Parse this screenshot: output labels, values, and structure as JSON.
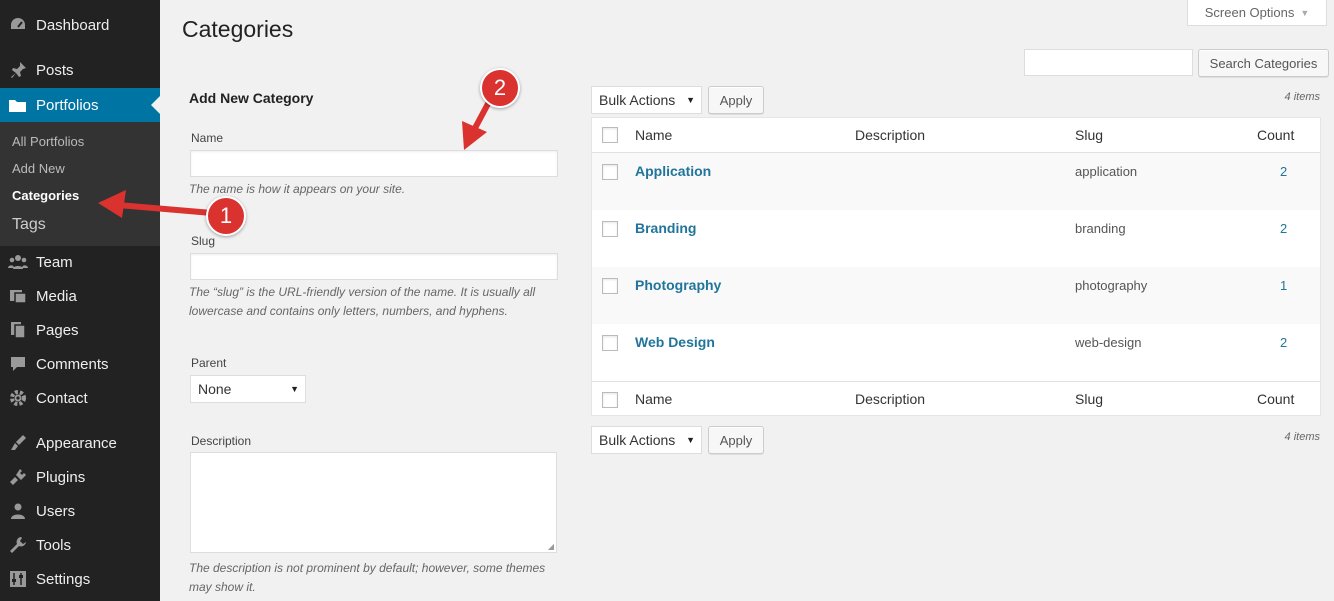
{
  "sidebar": {
    "menu": [
      {
        "label": "Dashboard",
        "icon": "dashboard-icon"
      },
      {
        "label": "Posts",
        "icon": "pin-icon"
      },
      {
        "label": "Portfolios",
        "icon": "folder-icon"
      },
      {
        "label": "Team",
        "icon": "group-icon"
      },
      {
        "label": "Media",
        "icon": "media-icon"
      },
      {
        "label": "Pages",
        "icon": "pages-icon"
      },
      {
        "label": "Comments",
        "icon": "comment-icon"
      },
      {
        "label": "Contact",
        "icon": "gear-icon"
      },
      {
        "label": "Appearance",
        "icon": "brush-icon"
      },
      {
        "label": "Plugins",
        "icon": "plug-icon"
      },
      {
        "label": "Users",
        "icon": "user-icon"
      },
      {
        "label": "Tools",
        "icon": "wrench-icon"
      },
      {
        "label": "Settings",
        "icon": "sliders-icon"
      }
    ],
    "submenu": [
      "All Portfolios",
      "Add New",
      "Categories",
      "Tags"
    ]
  },
  "header": {
    "title": "Categories",
    "screen_options": "Screen Options",
    "search_button": "Search Categories",
    "search_value": ""
  },
  "form": {
    "heading": "Add New Category",
    "name_label": "Name",
    "name_help": "The name is how it appears on your site.",
    "slug_label": "Slug",
    "slug_help_1": "The “slug” is the URL-friendly version of the name. It is usually all",
    "slug_help_2": "lowercase and contains only letters, numbers, and hyphens.",
    "parent_label": "Parent",
    "parent_value": "None",
    "description_label": "Description",
    "description_help_1": "The description is not prominent by default; however, some themes",
    "description_help_2": "may show it."
  },
  "table": {
    "bulk_actions": "Bulk Actions",
    "apply": "Apply",
    "items_count": "4 items",
    "columns": [
      "Name",
      "Description",
      "Slug",
      "Count"
    ],
    "rows": [
      {
        "name": "Application",
        "slug": "application",
        "count": "2"
      },
      {
        "name": "Branding",
        "slug": "branding",
        "count": "2"
      },
      {
        "name": "Photography",
        "slug": "photography",
        "count": "1"
      },
      {
        "name": "Web Design",
        "slug": "web-design",
        "count": "2"
      }
    ]
  },
  "annotations": {
    "marker_1": "1",
    "marker_2": "2",
    "color": "#d9322f"
  },
  "colors": {
    "sidebar_bg": "#222222",
    "active_bg": "#0074a2",
    "link": "#21759b"
  }
}
